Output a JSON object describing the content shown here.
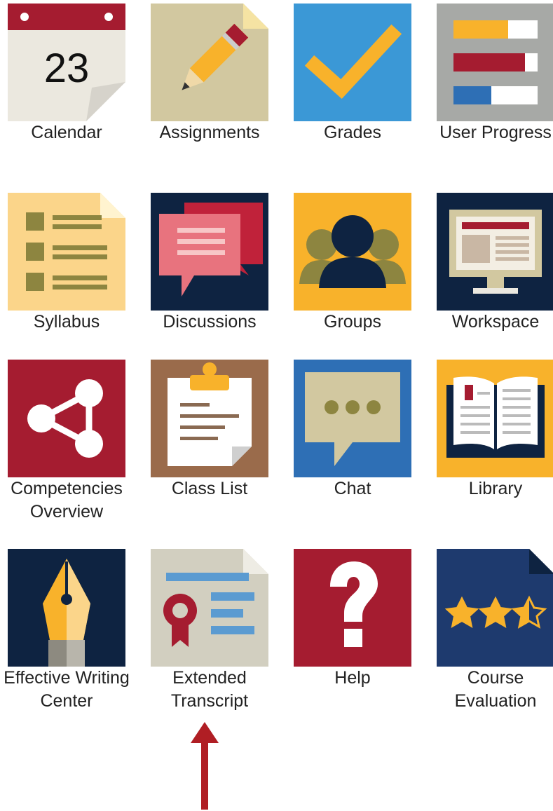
{
  "tiles": [
    {
      "label": "Calendar",
      "icon": "calendar-icon",
      "calendar_day": "23"
    },
    {
      "label": "Assignments",
      "icon": "pencil-icon"
    },
    {
      "label": "Grades",
      "icon": "checkmark-icon"
    },
    {
      "label": "User Progress",
      "icon": "progress-bars-icon"
    },
    {
      "label": "Syllabus",
      "icon": "list-document-icon"
    },
    {
      "label": "Discussions",
      "icon": "speech-bubbles-icon"
    },
    {
      "label": "Groups",
      "icon": "people-icon"
    },
    {
      "label": "Workspace",
      "icon": "monitor-icon"
    },
    {
      "label": "Competencies Overview",
      "icon": "share-nodes-icon"
    },
    {
      "label": "Class List",
      "icon": "clipboard-icon"
    },
    {
      "label": "Chat",
      "icon": "chat-bubble-icon"
    },
    {
      "label": "Library",
      "icon": "open-book-icon"
    },
    {
      "label": "Effective Writing Center",
      "icon": "pen-nib-icon"
    },
    {
      "label": "Extended Transcript",
      "icon": "certificate-icon"
    },
    {
      "label": "Help",
      "icon": "question-mark-icon"
    },
    {
      "label": "Course Evaluation",
      "icon": "star-rating-icon",
      "rating": 2.5
    }
  ],
  "colors": {
    "maroon": "#a51c30",
    "navy": "#0e2341",
    "gold": "#f8b22b",
    "blue": "#3b98d6",
    "beige": "#d2c8a0",
    "brown": "#9a6b4b",
    "gray": "#a7a9a6"
  }
}
